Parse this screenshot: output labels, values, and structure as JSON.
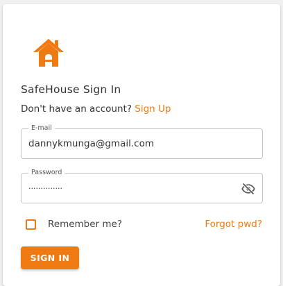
{
  "brand": {
    "accent_color": "#f07a12",
    "logo_icon": "house-icon"
  },
  "form": {
    "title": "SafeHouse Sign In",
    "signup_prompt": "Don't have an account?",
    "signup_link": "Sign Up",
    "email": {
      "label": "E-mail",
      "value": "dannykmunga@gmail.com"
    },
    "password": {
      "label": "Password",
      "masked_value": "··············",
      "toggle_icon": "eye-slash-icon"
    },
    "remember_label": "Remember me?",
    "remember_checked": false,
    "forgot_link": "Forgot pwd?",
    "submit_label": "SIGN IN"
  }
}
